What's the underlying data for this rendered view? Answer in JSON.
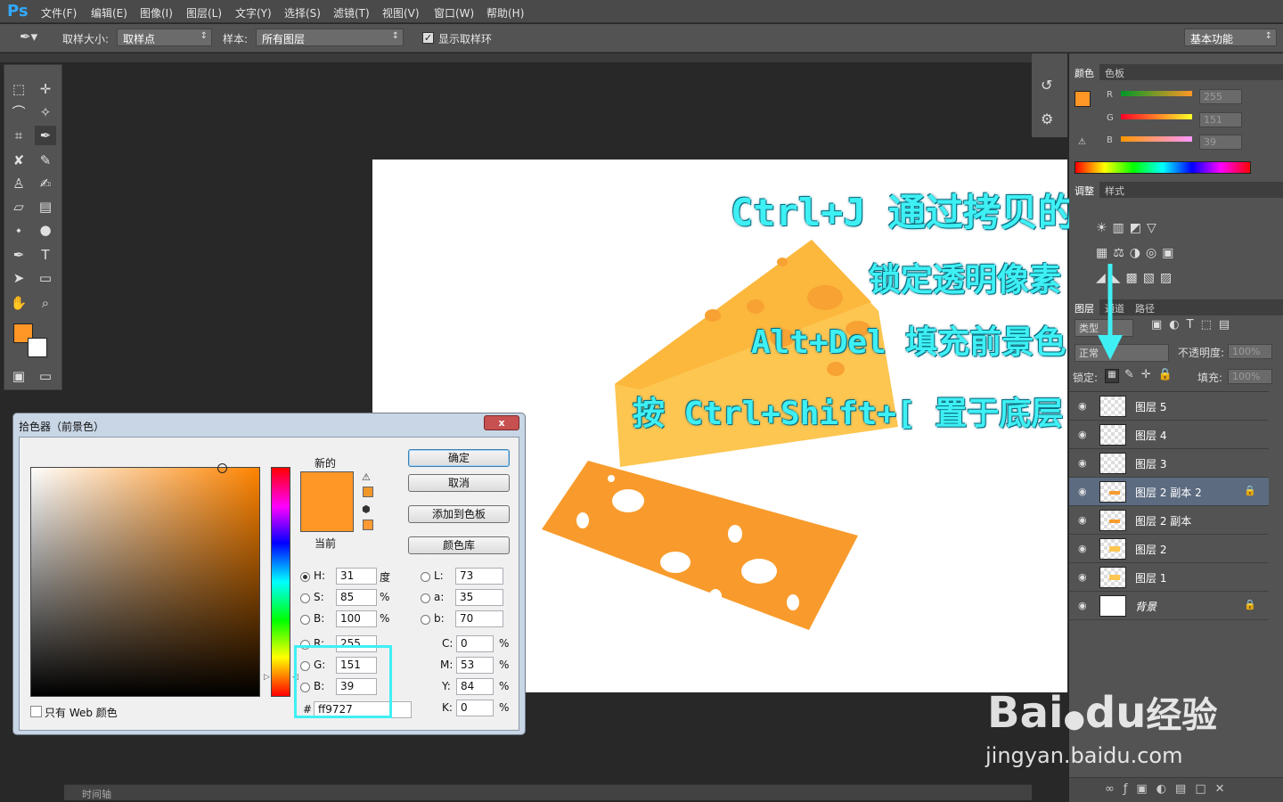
{
  "app": {
    "logo": "Ps"
  },
  "menu": [
    "文件(F)",
    "编辑(E)",
    "图像(I)",
    "图层(L)",
    "文字(Y)",
    "选择(S)",
    "滤镜(T)",
    "视图(V)",
    "窗口(W)",
    "帮助(H)"
  ],
  "options": {
    "sample_size_label": "取样大小:",
    "sample_size_value": "取样点",
    "sample_label": "样本:",
    "sample_value": "所有图层",
    "show_ring_label": "显示取样环",
    "workspace": "基本功能"
  },
  "colors": {
    "foreground": "#ff9727",
    "background": "#ffffff",
    "annotation": "#3ef0f4"
  },
  "annotations": {
    "line1": "Ctrl+J 通过拷贝的图层",
    "line2": "锁定透明像素",
    "line3": "Alt+Del 填充前景色",
    "line4": "按 Ctrl+Shift+[ 置于底层"
  },
  "color_panel": {
    "tabs": [
      "颜色",
      "色板"
    ],
    "r_label": "R",
    "r_value": "255",
    "g_label": "G",
    "g_value": "151",
    "b_label": "B",
    "b_value": "39"
  },
  "adjust_panel": {
    "tabs": [
      "调整",
      "样式"
    ]
  },
  "layers_panel": {
    "tabs": [
      "图层",
      "通道",
      "路径"
    ],
    "kind_label": "类型",
    "blend_mode": "正常",
    "opacity_label": "不透明度:",
    "opacity_value": "100%",
    "lock_label": "锁定:",
    "fill_label": "填充:",
    "fill_value": "100%",
    "layers": [
      {
        "name": "图层 5"
      },
      {
        "name": "图层 4"
      },
      {
        "name": "图层 3"
      },
      {
        "name": "图层 2 副本 2"
      },
      {
        "name": "图层 2 副本"
      },
      {
        "name": "图层 2"
      },
      {
        "name": "图层 1"
      },
      {
        "name": "背景"
      }
    ],
    "selected_index": 3
  },
  "dialog": {
    "title": "拾色器（前景色）",
    "close": "x",
    "new_label": "新的",
    "current_label": "当前",
    "ok": "确定",
    "cancel": "取消",
    "add_swatch": "添加到色板",
    "color_lib": "颜色库",
    "web_only": "只有 Web 颜色",
    "fields": {
      "H": {
        "label": "H:",
        "value": "31",
        "unit": "度"
      },
      "S": {
        "label": "S:",
        "value": "85",
        "unit": "%"
      },
      "B": {
        "label": "B:",
        "value": "100",
        "unit": "%"
      },
      "R": {
        "label": "R:",
        "value": "255"
      },
      "G": {
        "label": "G:",
        "value": "151"
      },
      "Bl": {
        "label": "B:",
        "value": "39"
      },
      "L": {
        "label": "L:",
        "value": "73"
      },
      "a": {
        "label": "a:",
        "value": "35"
      },
      "b": {
        "label": "b:",
        "value": "70"
      },
      "C": {
        "label": "C:",
        "value": "0",
        "unit": "%"
      },
      "M": {
        "label": "M:",
        "value": "53",
        "unit": "%"
      },
      "Y": {
        "label": "Y:",
        "value": "84",
        "unit": "%"
      },
      "K": {
        "label": "K:",
        "value": "0",
        "unit": "%"
      },
      "hex_label": "#",
      "hex": "ff9727"
    }
  },
  "timeline": {
    "label": "时间轴"
  },
  "watermark": {
    "brand": "Bai",
    "brand2": "du",
    "cn": "经验",
    "url": "jingyan.baidu.com"
  }
}
